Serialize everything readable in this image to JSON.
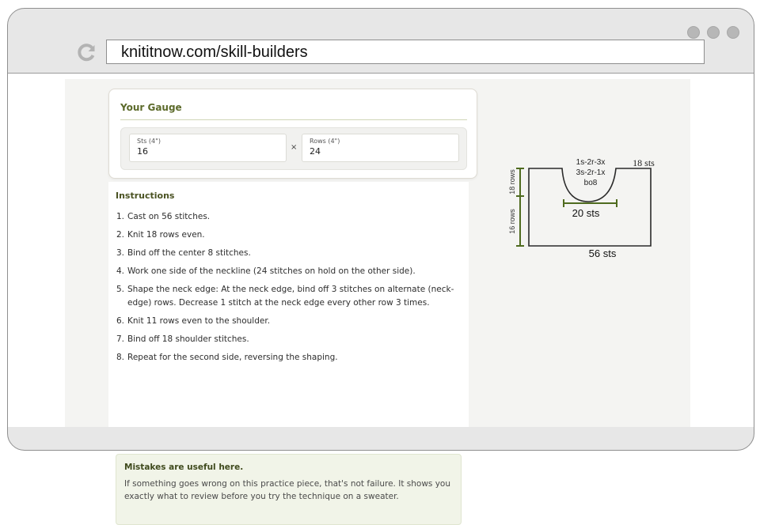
{
  "browser": {
    "url": "knititnow.com/skill-builders"
  },
  "gauge": {
    "title": "Your Gauge",
    "sts_label": "Sts (4\")",
    "sts_value": "16",
    "separator": "×",
    "rows_label": "Rows (4\")",
    "rows_value": "24"
  },
  "instructions": {
    "title": "Instructions",
    "steps": [
      {
        "num": "1.",
        "text": "Cast on 56 stitches."
      },
      {
        "num": "2.",
        "text": "Knit 18 rows even."
      },
      {
        "num": "3.",
        "text": "Bind off the center 8 stitches."
      },
      {
        "num": "4.",
        "text": "Work one side of the neckline (24 stitches on hold on the other side)."
      },
      {
        "num": "5.",
        "text": "Shape the neck edge: At the neck edge, bind off 3 stitches on alternate (neck-edge) rows. Decrease 1 stitch at the neck edge every other row 3 times."
      },
      {
        "num": "6.",
        "text": "Knit 11 rows even to the shoulder."
      },
      {
        "num": "7.",
        "text": "Bind off 18 shoulder stitches."
      },
      {
        "num": "8.",
        "text": "Repeat for the second side, reversing the shaping."
      }
    ]
  },
  "tip": {
    "title": "Mistakes are useful here.",
    "text": "If something goes wrong on this practice piece, that's not failure. It shows you exactly what to review before you try the technique on a sweater."
  },
  "diagram": {
    "neck_line1": "1s-2r-3x",
    "neck_line2": "3s-2r-1x",
    "neck_line3": "bo8",
    "shoulder_label": "18 sts",
    "neck_width_label": "20 sts",
    "bottom_label": "56 sts",
    "upper_rows_label": "18 rows",
    "lower_rows_label": "16 rows",
    "accent_color": "#4f6b1f"
  }
}
